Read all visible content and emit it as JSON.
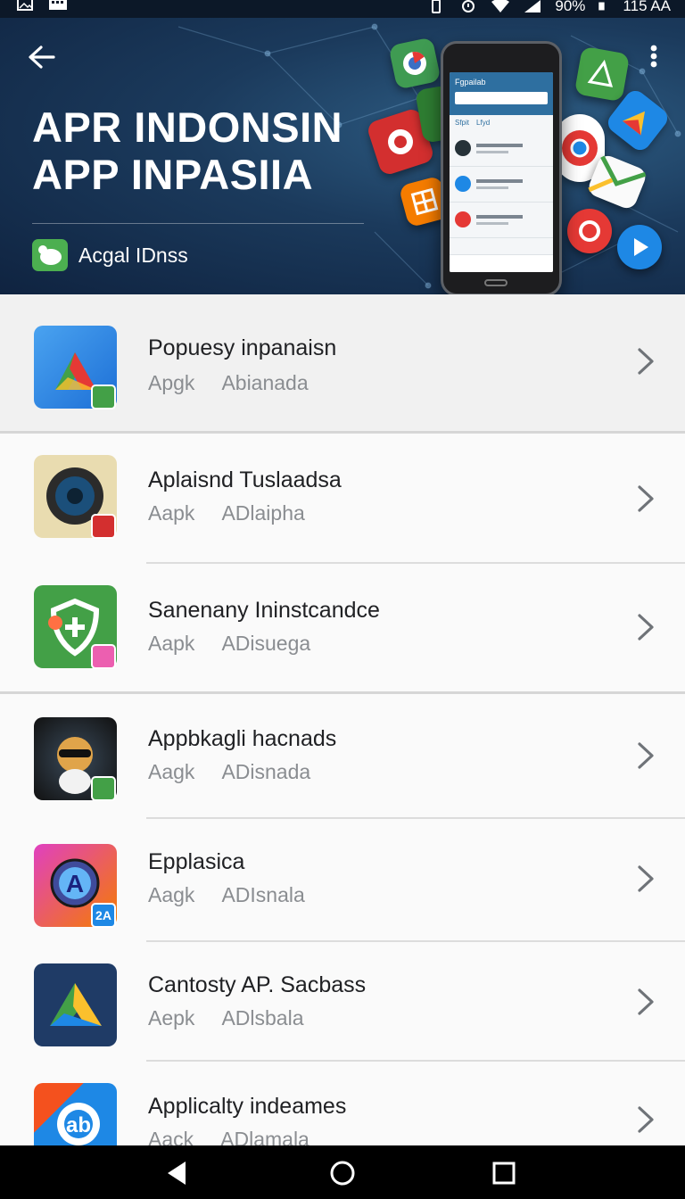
{
  "status_bar": {
    "battery_text": "90%",
    "time": "115 AA",
    "icons": [
      "image-icon",
      "keyboard-icon",
      "vibrate-icon",
      "alarm-icon",
      "wifi-icon",
      "signal-icon",
      "battery-icon"
    ]
  },
  "header": {
    "title_line1": "APR INDONSIN",
    "title_line2": "APP INPASIIA",
    "badge_label": "Acgal IDnss",
    "phone_title": "Fgpailab",
    "phone_tab1": "Sfpit",
    "phone_tab2": "Lfyd"
  },
  "apps": [
    {
      "name": "Popuesy inpanaisn",
      "meta1": "Apgk",
      "meta2": "Abianada",
      "icon": "triangle-app-icon"
    },
    {
      "name": "Aplaisnd Tuslaadsa",
      "meta1": "Aapk",
      "meta2": "ADlaipha",
      "icon": "speaker-app-icon"
    },
    {
      "name": "Sanenany Ininstcandce",
      "meta1": "Aapk",
      "meta2": "ADisuega",
      "icon": "shield-app-icon"
    },
    {
      "name": "Appbkagli hacnads",
      "meta1": "Aagk",
      "meta2": "ADisnada",
      "icon": "character-app-icon"
    },
    {
      "name": "Epplasica",
      "meta1": "Aagk",
      "meta2": "ADIsnala",
      "icon": "location-app-icon",
      "badge_text": "2A"
    },
    {
      "name": "Cantosty AP. Sacbass",
      "meta1": "Aepk",
      "meta2": "ADlsbala",
      "icon": "drive-app-icon"
    },
    {
      "name": "Applicalty indeames",
      "meta1": "Aack",
      "meta2": "ADlamala",
      "icon": "link-app-icon"
    }
  ],
  "colors": {
    "hero_bg": "#1b3a5c",
    "accent_green": "#43a047",
    "text_primary": "#202124",
    "text_secondary": "#8a8d91"
  }
}
